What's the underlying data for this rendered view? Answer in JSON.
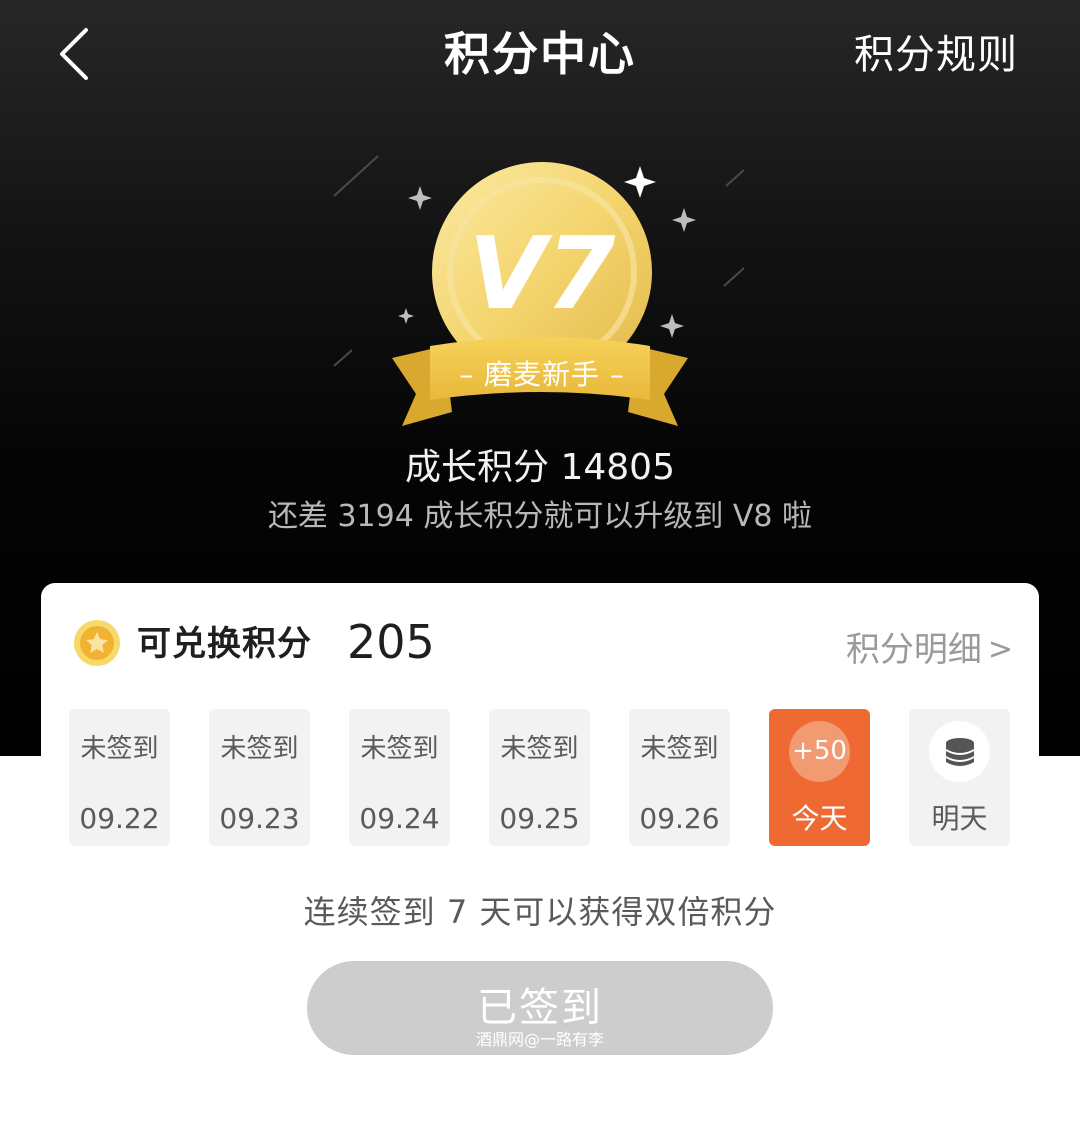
{
  "header": {
    "title": "积分中心",
    "rules_label": "积分规则"
  },
  "level": {
    "badge": "V7",
    "rank_name": "磨麦新手",
    "growth_label": "成长积分 14805",
    "growth_points": 14805,
    "upgrade_hint": "还差 3194 成长积分就可以升级到 V8 啦"
  },
  "points": {
    "label": "可兑换积分",
    "value": "205",
    "detail_label": "积分明细",
    "detail_chevron": ">"
  },
  "checkin": {
    "days": [
      {
        "status": "未签到",
        "date": "09.22"
      },
      {
        "status": "未签到",
        "date": "09.23"
      },
      {
        "status": "未签到",
        "date": "09.24"
      },
      {
        "status": "未签到",
        "date": "09.25"
      },
      {
        "status": "未签到",
        "date": "09.26"
      }
    ],
    "today": {
      "bonus": "+50",
      "label": "今天"
    },
    "tomorrow": {
      "label": "明天"
    },
    "streak_tip": "连续签到 7 天可以获得双倍积分",
    "button_label": "已签到"
  },
  "watermark": "酒鼎网@一路有李",
  "colors": {
    "accent": "#ef6a33",
    "gold": "#f5cf5a",
    "hero_bg": "#000000",
    "button_disabled": "#cdcdcd"
  }
}
